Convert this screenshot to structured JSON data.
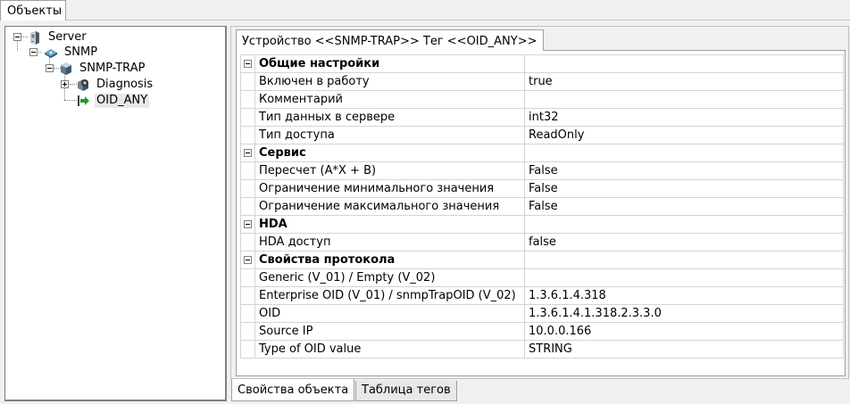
{
  "top_tab": {
    "label": "Объекты"
  },
  "tree": {
    "nodes": [
      {
        "label": "Server",
        "icon": "server-icon",
        "expanded": true
      },
      {
        "label": "SNMP",
        "icon": "network-driver-icon",
        "expanded": true
      },
      {
        "label": "SNMP-TRAP",
        "icon": "device-icon",
        "expanded": true
      },
      {
        "label": "Diagnosis",
        "icon": "diagnosis-gear-icon",
        "expanded": false
      },
      {
        "label": "OID_ANY",
        "icon": "tag-arrow-icon",
        "selected": true
      }
    ]
  },
  "device_tab": {
    "label": "Устройство <<SNMP-TRAP>> Тег  <<OID_ANY>>"
  },
  "properties": {
    "general": {
      "title": "Общие настройки",
      "rows": [
        {
          "name": "Включен в работу",
          "value": "true"
        },
        {
          "name": "Комментарий",
          "value": ""
        },
        {
          "name": "Тип данных в сервере",
          "value": "int32"
        },
        {
          "name": "Тип доступа",
          "value": "ReadOnly"
        }
      ]
    },
    "service": {
      "title": "Сервис",
      "rows": [
        {
          "name": "Пересчет (A*X + B)",
          "value": "False"
        },
        {
          "name": "Ограничение минимального значения",
          "value": "False"
        },
        {
          "name": "Ограничение максимального значения",
          "value": "False"
        }
      ]
    },
    "hda": {
      "title": "HDA",
      "rows": [
        {
          "name": "HDA доступ",
          "value": "false"
        }
      ]
    },
    "protocol": {
      "title": "Свойства протокола",
      "rows": [
        {
          "name": "Generic (V_01) / Empty (V_02)",
          "value": ""
        },
        {
          "name": "Enterprise OID (V_01) / snmpTrapOID (V_02)",
          "value": "1.3.6.1.4.318"
        },
        {
          "name": "OID",
          "value": "1.3.6.1.4.1.318.2.3.3.0"
        },
        {
          "name": "Source IP",
          "value": "10.0.0.166"
        },
        {
          "name": "Type of OID value",
          "value": "STRING"
        }
      ]
    }
  },
  "bottom_tabs": [
    {
      "label": "Свойства объекта",
      "active": true
    },
    {
      "label": "Таблица тегов",
      "active": false
    }
  ]
}
